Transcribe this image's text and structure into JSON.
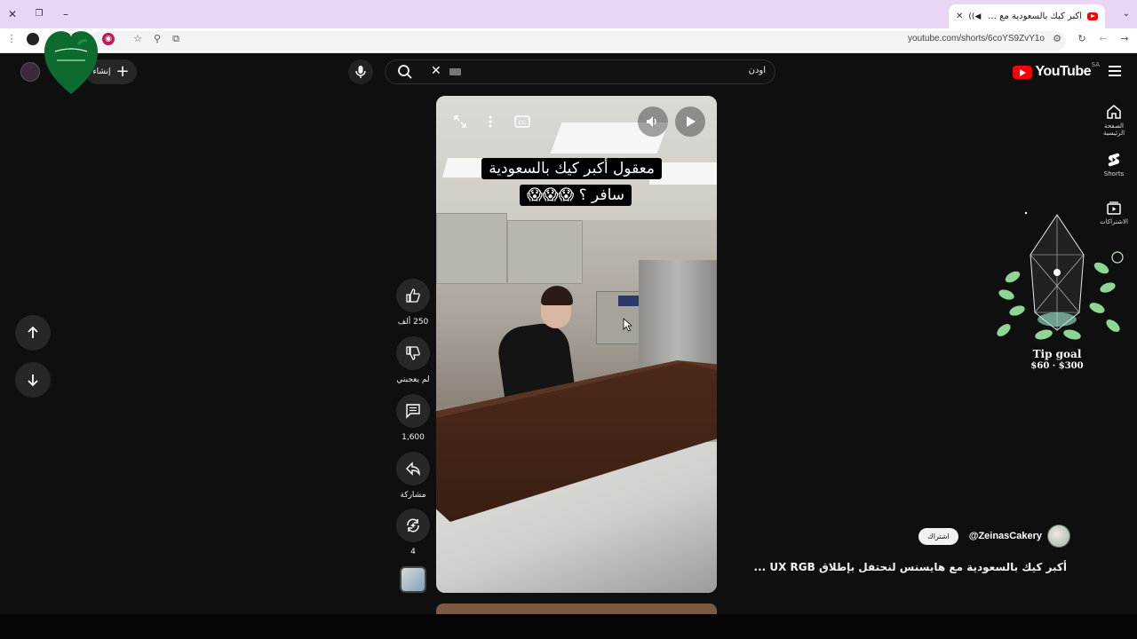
{
  "browser": {
    "tab_title": "أكبر كيك بالسعودية مع هايـ...",
    "url": "youtube.com/shorts/6coYS9ZvY1o"
  },
  "header": {
    "logo_text": "YouTube",
    "logo_country": "SA",
    "search_value": "اودن",
    "create_label": "إنشاء"
  },
  "side_nav": {
    "items": [
      {
        "label": "الصفحة الرئيسية",
        "icon": "home-icon"
      },
      {
        "label": "Shorts",
        "icon": "shorts-icon"
      },
      {
        "label": "الاشتراكات",
        "icon": "subscriptions-icon"
      }
    ]
  },
  "video": {
    "caption_line1": "معقول أكبر كيك بالسعودية",
    "caption_line2": "سافر ؟ 😱😱😱"
  },
  "actions": {
    "like_count": "250 ألف",
    "dislike_label": "لم يعجبني",
    "comments_count": "1,600",
    "share_label": "مشاركة",
    "remix_count": "4"
  },
  "channel": {
    "handle": "@ZeinasCakery",
    "subscribe_label": "اشتراك"
  },
  "video_title": "أكبر كيك بالسعودية مع هايسنس لنحتفل بإطلاق UX RGB ...",
  "tip_goal": {
    "title": "Tip goal",
    "amount": "$60 · $300"
  },
  "colors": {
    "background": "#0f0f0f",
    "youtube_red": "#ff0000",
    "tab_strip": "#e9d5f5"
  }
}
